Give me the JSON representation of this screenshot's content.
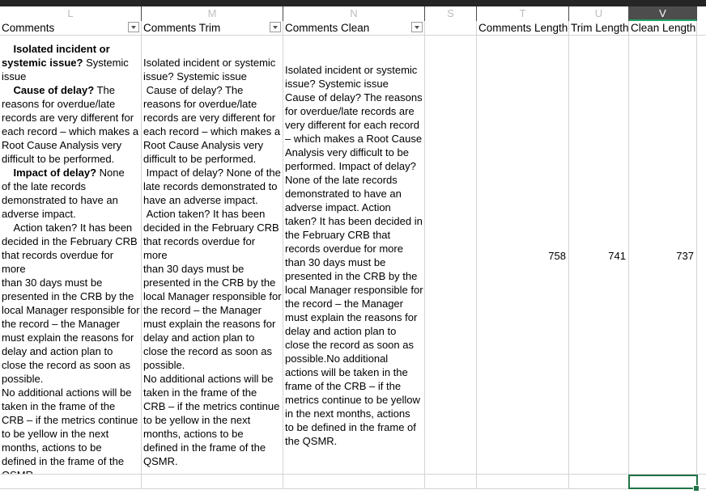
{
  "columns": [
    "L",
    "M",
    "N",
    "S",
    "T",
    "U",
    "V"
  ],
  "headers": {
    "comments": "Comments",
    "comments_trim": "Comments Trim",
    "comments_clean": "Comments Clean",
    "comments_length": "Comments Length",
    "trim_length": "Trim Length",
    "clean_length": "Clean Length"
  },
  "row": {
    "comments_lines": [
      {
        "t": "    Isolated incident or",
        "b": true
      },
      {
        "t": "systemic issue?",
        "b": true,
        "rest": " Systemic"
      },
      {
        "t": "issue"
      },
      {
        "t": "    Cause of delay?",
        "b": true,
        "rest": " The"
      },
      {
        "t": "reasons for overdue/late"
      },
      {
        "t": "records are very different for"
      },
      {
        "t": "each record – which makes a"
      },
      {
        "t": "Root Cause Analysis very"
      },
      {
        "t": "difficult to be performed."
      },
      {
        "t": "    Impact of delay?",
        "b": true,
        "rest": " None"
      },
      {
        "t": "of the late records"
      },
      {
        "t": "demonstrated to have an"
      },
      {
        "t": "adverse impact."
      },
      {
        "t": "    Action taken? It has been"
      },
      {
        "t": "decided in the February CRB"
      },
      {
        "t": "that records overdue for more"
      },
      {
        "t": "than 30 days must be"
      },
      {
        "t": "presented in the CRB by the"
      },
      {
        "t": "local Manager responsible for"
      },
      {
        "t": "the record – the Manager"
      },
      {
        "t": "must explain the reasons for"
      },
      {
        "t": "delay and action plan to"
      },
      {
        "t": "close the record as soon as"
      },
      {
        "t": "possible."
      },
      {
        "t": "No additional actions will be"
      },
      {
        "t": "taken in the frame of the"
      },
      {
        "t": "CRB – if the metrics continue"
      },
      {
        "t": "to be yellow in the next"
      },
      {
        "t": "months, actions to be"
      },
      {
        "t": "defined in the frame of the"
      },
      {
        "t": "QSMR."
      }
    ],
    "comments_trim": "Isolated incident or systemic\nissue? Systemic issue\n Cause of delay? The\nreasons for overdue/late\nrecords are very different for\neach record – which makes a\nRoot Cause Analysis very\ndifficult to be performed.\n Impact of delay? None of the\nlate records demonstrated to\nhave an adverse impact.\n Action taken? It has been\ndecided in the February CRB\nthat records overdue for more\nthan 30 days must be\npresented in the CRB by the\nlocal Manager responsible for\nthe record – the Manager\nmust explain the reasons for\ndelay and action plan to\nclose the record as soon as\npossible.\nNo additional actions will be\ntaken in the frame of the\nCRB – if the metrics continue\nto be yellow in the next\nmonths, actions to be\ndefined in the frame of the\nQSMR.",
    "comments_clean": "Isolated incident or systemic\nissue? Systemic issue\nCause of delay? The reasons\nfor overdue/late records are\nvery different for each record\n– which makes a Root Cause\nAnalysis very difficult to be\nperformed. Impact of delay?\nNone of the late records\ndemonstrated to have an\nadverse impact. Action\ntaken? It has been decided in\nthe February CRB that\nrecords overdue for more\nthan 30 days must be\npresented in the CRB by the\nlocal Manager responsible for\nthe record – the Manager\nmust explain the reasons for\ndelay and action plan to\nclose the record as soon as\npossible.No additional\nactions will be taken in the\nframe of the CRB – if the\nmetrics continue to be yellow\nin the next months, actions\nto be defined in the frame of\nthe QSMR.",
    "comments_length": "758",
    "trim_length": "741",
    "clean_length": "737"
  },
  "selected_column": "V",
  "accent_color": "#217346"
}
